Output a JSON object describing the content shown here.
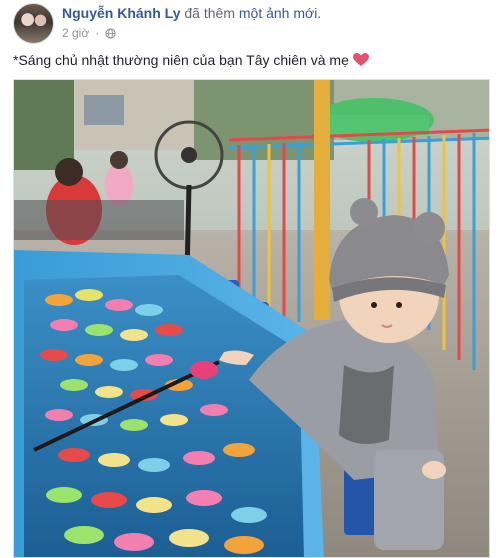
{
  "post": {
    "author_name": "Nguyễn Khánh Ly",
    "action_prefix": "đã thêm",
    "action_object": "một ảnh mới.",
    "timestamp": "2 giờ",
    "audience_icon": "globe-icon",
    "caption_text": "*Sáng chủ nhật thường niên của bạn Tây chiên và mẹ",
    "caption_emoji": "heart-icon",
    "emoji_color": "#e2526a",
    "link_color": "#365899"
  }
}
